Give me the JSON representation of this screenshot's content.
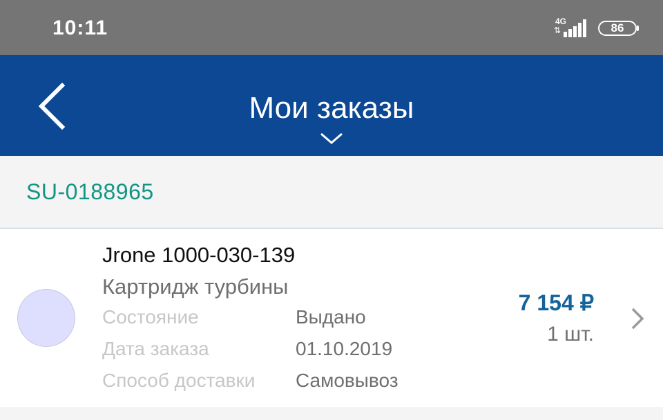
{
  "status_bar": {
    "time": "10:11",
    "network": "4G",
    "battery": "86"
  },
  "app_bar": {
    "title": "Мои заказы",
    "back_icon": "chevron-left-icon",
    "dropdown_icon": "chevron-down-icon"
  },
  "order": {
    "id": "SU-0188965",
    "item": {
      "sku": "Jrone 1000-030-139",
      "name": "Картридж турбины",
      "details": [
        {
          "label": "Состояние",
          "value": "Выдано"
        },
        {
          "label": "Дата заказа",
          "value": "01.10.2019"
        },
        {
          "label": "Способ доставки",
          "value": "Самовывоз"
        }
      ],
      "price": "7 154 ₽",
      "quantity": "1 шт."
    }
  },
  "colors": {
    "status_bar": "#757575",
    "app_bar": "#0c4893",
    "order_id": "#119584",
    "price": "#15639b"
  }
}
